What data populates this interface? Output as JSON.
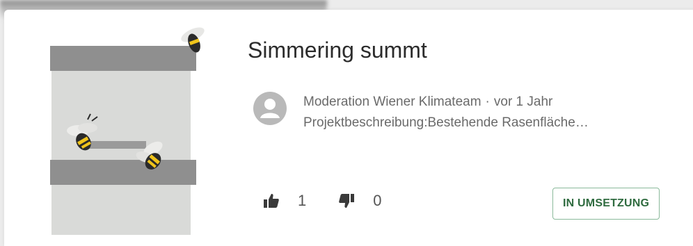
{
  "card": {
    "title": "Simmering summt",
    "author": "Moderation Wiener Klimateam",
    "separator": "·",
    "time": "vor 1 Jahr",
    "excerpt": "Projektbeschreibung:Bestehende Rasenfläche…",
    "likes": "1",
    "dislikes": "0",
    "status": "IN UMSETZUNG",
    "icons": {
      "avatar": "user-avatar-icon",
      "like": "thumbs-up-icon",
      "dislike": "thumbs-down-icon",
      "image": "bee-illustration"
    },
    "colors": {
      "status_border": "#8ab99a",
      "status_text": "#2f6b3f",
      "title": "#2c2c2c"
    }
  }
}
